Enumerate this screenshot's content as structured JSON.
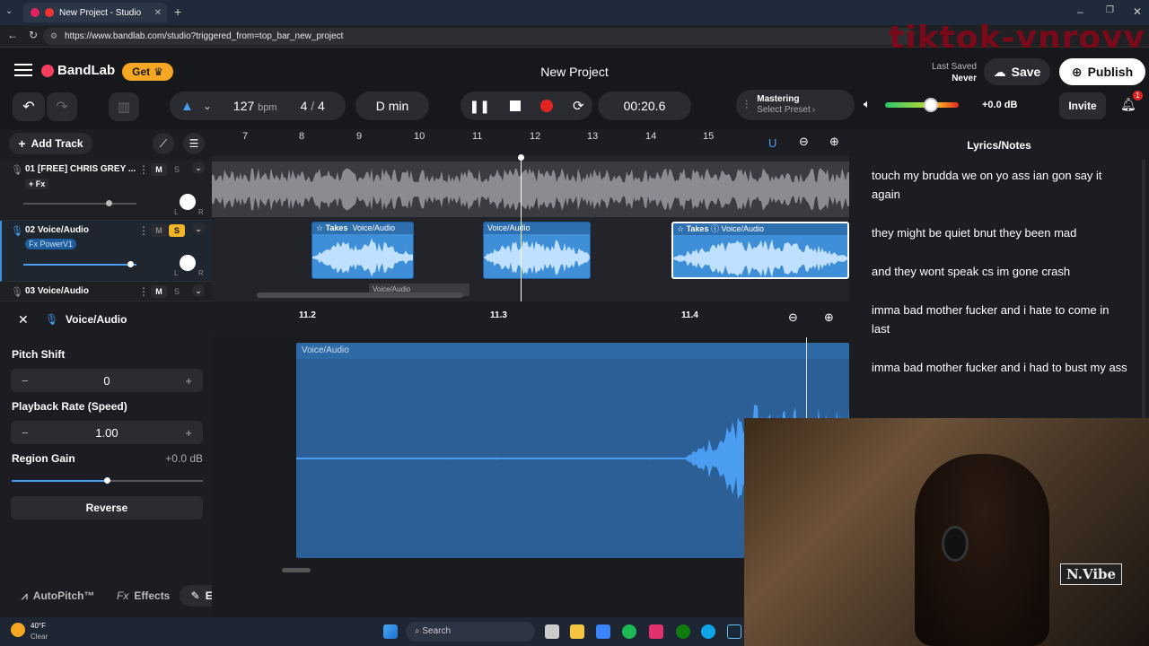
{
  "browser": {
    "tab_title": "New Project - Studio",
    "url": "https://www.bandlab.com/studio?triggered_from=top_bar_new_project",
    "overlay_text": "tiktok-ynroyy"
  },
  "header": {
    "brand": "BandLab",
    "get_label": "Get",
    "project_title": "New Project",
    "last_saved_label": "Last Saved",
    "last_saved_value": "Never",
    "save_label": "Save",
    "publish_label": "Publish"
  },
  "toolbar": {
    "bpm_value": "127",
    "bpm_unit": "bpm",
    "time_sig_num": "4",
    "time_sig_sep": "/",
    "time_sig_den": "4",
    "key": "D min",
    "time": "00:20.6",
    "mastering_label": "Mastering",
    "mastering_preset": "Select Preset",
    "volume_db": "+0.0 dB",
    "volume_level": 0.62,
    "invite_label": "Invite",
    "notification_count": "1"
  },
  "tracks": {
    "add_track_label": "Add Track",
    "ruler": [
      "7",
      "8",
      "9",
      "10",
      "11",
      "12",
      "13",
      "14",
      "15"
    ],
    "items": [
      {
        "name": "01  [FREE] CHRIS GREY ...",
        "fx": "+ Fx",
        "mute": "M",
        "solo": "S"
      },
      {
        "name": "02  Voice/Audio",
        "fx": "Fx PowerV1",
        "mute": "M",
        "solo": "S"
      },
      {
        "name": "03  Voice/Audio",
        "mute": "M",
        "solo": "S"
      }
    ],
    "regions": [
      {
        "takes": "Takes",
        "title": "Voice/Audio"
      },
      {
        "title": "Voice/Audio"
      },
      {
        "takes": "Takes",
        "title": "Voice/Audio"
      }
    ],
    "collapsed_region": "Voice/Audio",
    "pan_left": "L",
    "pan_right": "R"
  },
  "editor": {
    "title": "Voice/Audio",
    "pitch_label": "Pitch Shift",
    "pitch_value": "0",
    "rate_label": "Playback Rate (Speed)",
    "rate_value": "1.00",
    "gain_label": "Region Gain",
    "gain_value": "+0.0 dB",
    "reverse_label": "Reverse",
    "ruler": [
      "11.2",
      "11.3",
      "11.4"
    ],
    "region_title": "Voice/Audio",
    "tabs": [
      "AutoPitch™",
      "Effects",
      "Editor"
    ],
    "effects_prefix": "Fx"
  },
  "lyrics": {
    "title": "Lyrics/Notes",
    "lines": [
      "touch my brudda we on yo ass ian gon say it again",
      "they might be quiet bnut they been mad",
      "and they wont speak cs im gone crash",
      "imma bad mother fucker and i hate to come in last",
      "imma bad mother fucker and i had to bust my ass"
    ]
  },
  "webcam": {
    "sign_text": "N.Vibe"
  },
  "taskbar": {
    "temp": "40°F",
    "weather": "Clear",
    "search_placeholder": "Search"
  },
  "colors": {
    "accent_blue": "#3f8ed8",
    "solo_yellow": "#f0b429",
    "record_red": "#e02424",
    "get_orange": "#f5a623"
  }
}
